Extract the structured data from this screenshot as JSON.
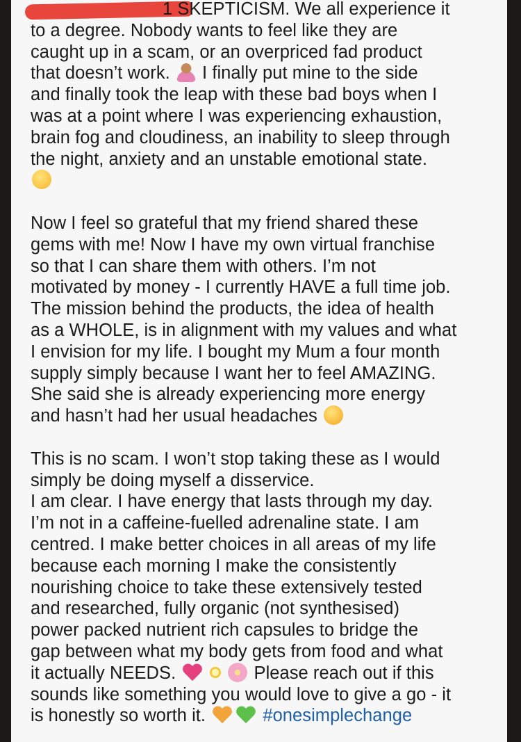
{
  "post": {
    "lines": [
      "1 SKEPTICISM. We all experience it",
      "to a degree. Nobody wants to feel like they are",
      "caught up in a scam, or an overpriced fad product",
      "that doesn’t work.",
      "I finally put mine to the side",
      "and finally took the leap with these bad boys when I",
      "was at a point where I was experiencing exhaustion,",
      "brain fog and cloudiness, an inability to sleep through",
      "the night, anxiety and an unstable emotional state.",
      "Now I feel so grateful that my friend shared these",
      "gems with me! Now I have my own virtual franchise",
      "so that I can share them with others. I’m not",
      "motivated by money - I currently HAVE a full time job.",
      "The mission behind the products, the idea of health",
      "as a WHOLE, is in alignment with my values and what",
      "I envision for my life. I bought my Mum a four month",
      "supply simply because I want her to feel AMAZING.",
      "She said she is already experiencing more energy",
      "and hasn’t had her usual headaches",
      "This is no scam. I won’t stop taking these as I would",
      "simply be doing myself a disservice.",
      "I am clear. I have energy that lasts through my day.",
      "I’m not in a caffeine-fuelled adrenaline state. I am",
      "centred. I make better choices in all areas of my life",
      "because each morning I make the consistently",
      "nourishing choice to take these extensively tested",
      "and researched, fully organic (not synthesised)",
      "power packed nutrient rich capsules to bridge the",
      "gap between what my body gets from food and what",
      "it actually NEEDS.",
      "Please reach out if this",
      "sounds like something you would love to give a go - it",
      "is honestly so worth it.",
      "#onesimplechange"
    ],
    "emojis": {
      "person": "person-gesturing-icon",
      "sleep": "sleepy-face-icon",
      "star_face": "star-struck-face-icon",
      "heart_pink": "sparkling-heart-icon",
      "sparkle": "glowing-star-icon",
      "blossom": "cherry-blossom-icon",
      "heart_orange": "orange-heart-icon",
      "heart_green": "green-heart-icon"
    },
    "colors": {
      "background": "#f7f7f7",
      "text": "#1b1b1b",
      "hashtag": "#1f5fa6",
      "redaction": "#e8453c",
      "frame": "#1c1a16"
    }
  }
}
